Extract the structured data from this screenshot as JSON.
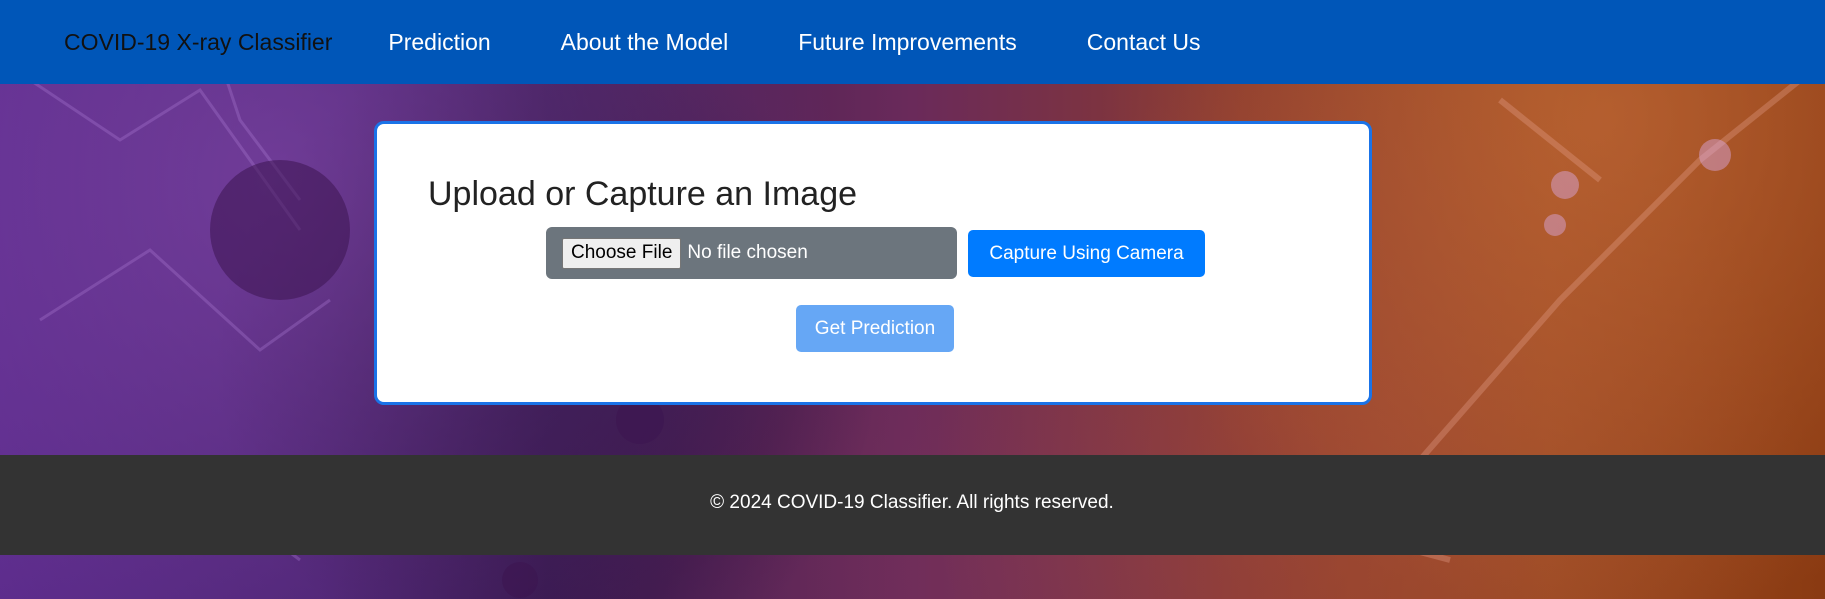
{
  "navbar": {
    "brand": "COVID-19 X-ray Classifier",
    "links": [
      {
        "label": "Prediction"
      },
      {
        "label": "About the Model"
      },
      {
        "label": "Future Improvements"
      },
      {
        "label": "Contact Us"
      }
    ]
  },
  "upload_card": {
    "title": "Upload or Capture an Image",
    "choose_file_label": "Choose File",
    "file_status": "No file chosen",
    "capture_button_label": "Capture Using Camera",
    "predict_button_label": "Get Prediction"
  },
  "footer": {
    "text": "© 2024 COVID-19 Classifier. All rights reserved."
  },
  "colors": {
    "navbar_bg": "#0056b8",
    "footer_bg": "#333333",
    "primary_button": "#007bff",
    "disabled_button": "#66a7f5",
    "file_box_bg": "#6c757d",
    "card_border": "#1a73e8"
  }
}
